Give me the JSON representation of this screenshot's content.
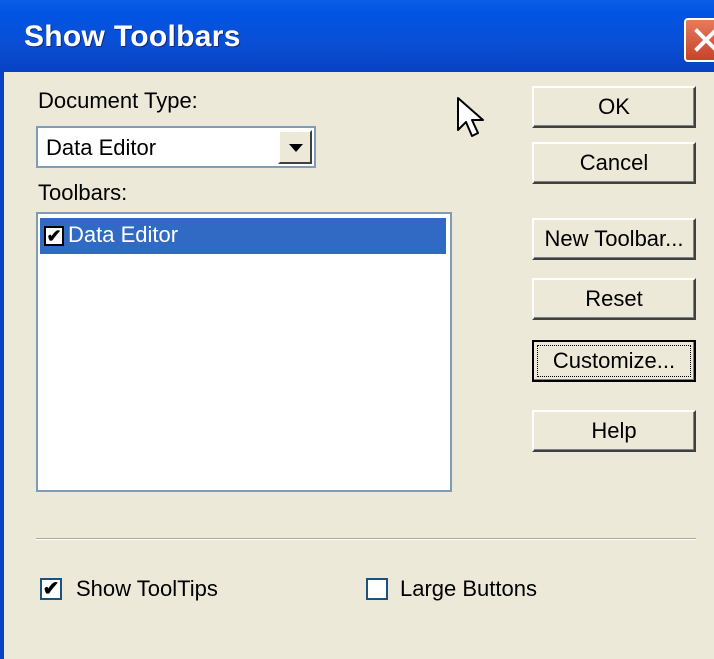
{
  "window": {
    "title": "Show Toolbars",
    "close_icon": "close-icon"
  },
  "document_type": {
    "label": "Document Type:",
    "selected": "Data Editor"
  },
  "toolbars": {
    "label": "Toolbars:",
    "items": [
      {
        "label": "Data Editor",
        "checked": true,
        "selected": true
      }
    ]
  },
  "buttons": {
    "ok": "OK",
    "cancel": "Cancel",
    "new_toolbar": "New Toolbar...",
    "reset": "Reset",
    "customize": "Customize...",
    "help": "Help"
  },
  "options": {
    "show_tooltips": {
      "label": "Show ToolTips",
      "checked": true
    },
    "large_buttons": {
      "label": "Large Buttons",
      "checked": false
    }
  },
  "colors": {
    "titlebar": "#0054e3",
    "selection": "#316ac5",
    "face": "#ece9d8"
  }
}
